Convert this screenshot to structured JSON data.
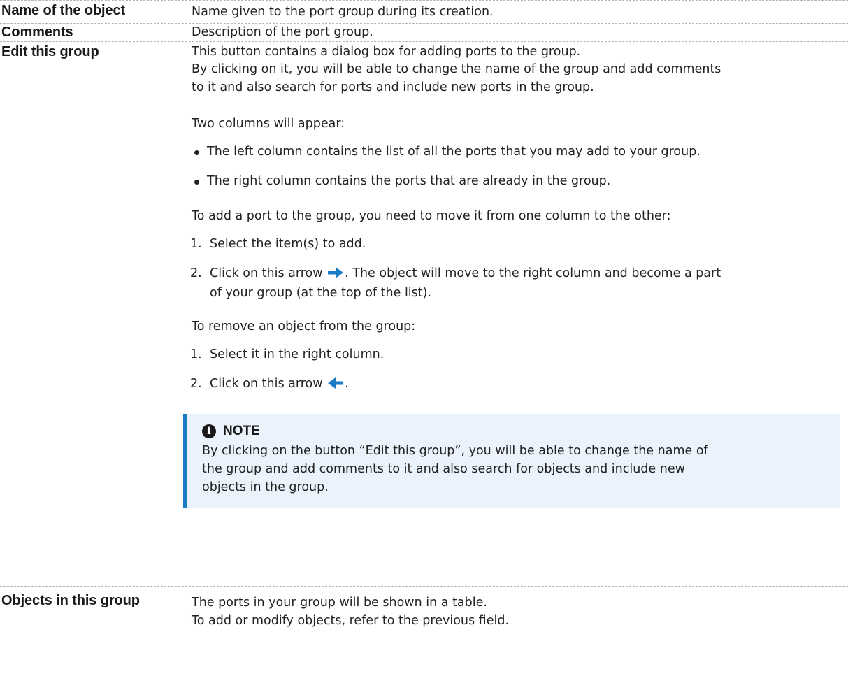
{
  "rows": [
    {
      "term": "Name of the object",
      "definition": "Name given to the port group during its creation."
    },
    {
      "term": "Comments",
      "definition": "Description of the port group."
    },
    {
      "term": "Edit this group",
      "line1": "This button contains a dialog box for adding ports to the group.",
      "line2": "By clicking on it, you will be able to change the name of the group and add comments",
      "line3": "to it and also search for ports and include new ports in the group.",
      "columns_intro": "Two columns will appear:",
      "bullets": [
        "The left column contains the list of all the ports that you may add to your group.",
        "The right column contains the ports that are already in the group."
      ],
      "add_intro": "To add a port to the group, you need to move it from one column to the other:",
      "add_steps": {
        "step1_num": "1.",
        "step1": "Select the item(s) to add.",
        "step2_num": "2.",
        "step2_before": "Click on this arrow",
        "step2_after": ". The object will move to the right column and become a part",
        "step2_line2": "of your group (at the top of the list)."
      },
      "remove_intro": "To remove an object from the group:",
      "remove_steps": {
        "step1_num": "1.",
        "step1": "Select it in the right column.",
        "step2_num": "2.",
        "step2_before": "Click on this arrow",
        "step2_after": "."
      },
      "note": {
        "title": "NOTE",
        "icon": "info-icon",
        "line1": "By clicking on the button “Edit this group”, you will be able to change the name of",
        "line2": "the group and add comments to it and also search for objects and include new",
        "line3": "objects in the group."
      }
    },
    {
      "term": "Objects in this group",
      "line1": "The ports in your group will be shown in a table.",
      "line2": "To add or modify objects, refer to the previous field."
    }
  ],
  "colors": {
    "arrow": "#1b7cc6",
    "note_background": "#eaf2fb",
    "note_border": "#1b7cc6",
    "row_divider": "#b5b5b5"
  },
  "icons": {
    "right_arrow": "arrow-right-icon",
    "left_arrow": "arrow-left-icon"
  }
}
